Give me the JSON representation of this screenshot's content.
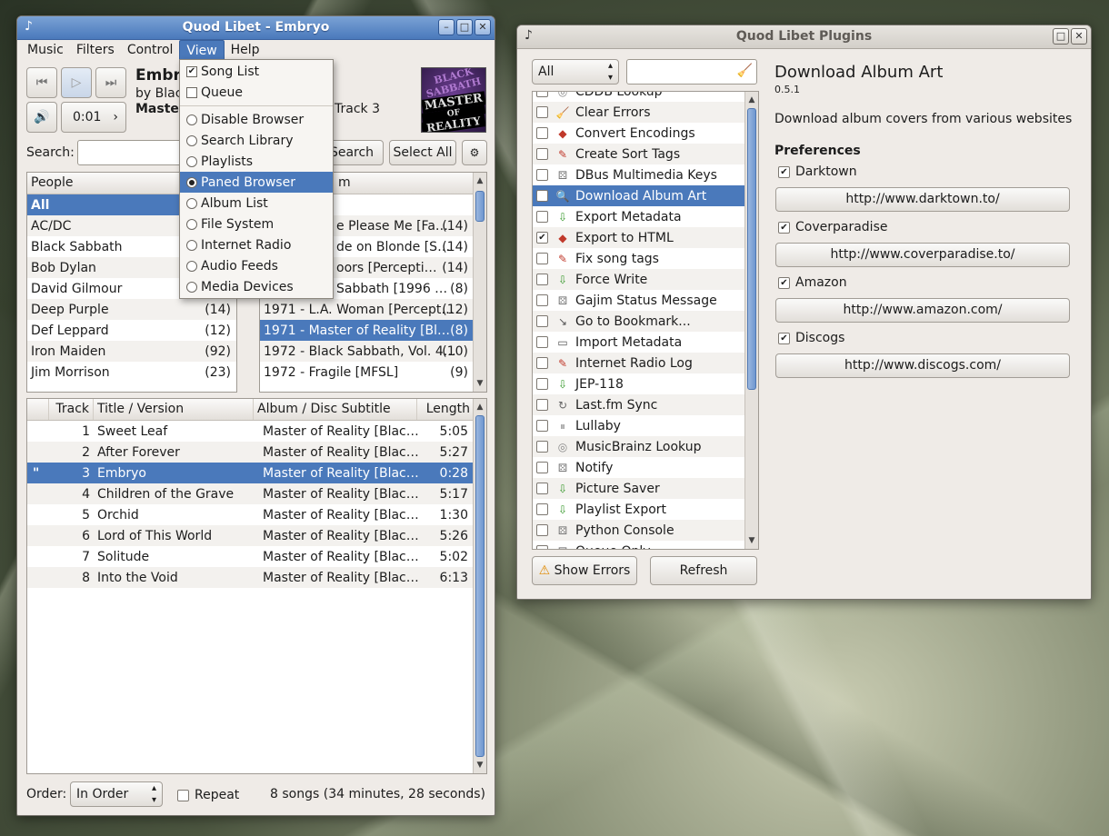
{
  "main": {
    "title": "Quod Libet - Embryo",
    "menus": [
      "Music",
      "Filters",
      "Control",
      "View",
      "Help"
    ],
    "now_playing": {
      "title": "Embryo",
      "by": "by Black Sabbath",
      "album": "Master of Reality",
      "track": "Track 3",
      "time": "0:01"
    },
    "cover": {
      "line1": "BLACK",
      "line2": "SABBATH",
      "line3": "MASTER",
      "line4": "OF",
      "line5": "REALITY"
    },
    "search_label": "Search:",
    "search_button": "Search",
    "select_all_button": "Select All",
    "people_header": "People",
    "people": [
      {
        "name": "All",
        "count": ""
      },
      {
        "name": "AC/DC",
        "count": ""
      },
      {
        "name": "Black Sabbath",
        "count": ""
      },
      {
        "name": "Bob Dylan",
        "count": ""
      },
      {
        "name": "David Gilmour",
        "count": ""
      },
      {
        "name": "Deep Purple",
        "count": "(14)"
      },
      {
        "name": "Def Leppard",
        "count": "(12)"
      },
      {
        "name": "Iron Maiden",
        "count": "(92)"
      },
      {
        "name": "Jim Morrison",
        "count": "(23)"
      }
    ],
    "albums_header": "m",
    "albums": [
      {
        "name": "e Please Me [Fa…",
        "count": "(14)"
      },
      {
        "name": "de on Blonde [S…",
        "count": "(14)"
      },
      {
        "name": "oors [Percepti…",
        "count": "(14)"
      },
      {
        "name": "Sabbath [1996 …",
        "count": "(8)"
      },
      {
        "name": "1971 - L.A. Woman [Percept…",
        "count": "(12)"
      },
      {
        "name": "1971 - Master of Reality [Bl…",
        "count": "(8)"
      },
      {
        "name": "1972 - Black Sabbath, Vol. 4…",
        "count": "(10)"
      },
      {
        "name": "1972 - Fragile [MFSL]",
        "count": "(9)"
      }
    ],
    "songs_headers": {
      "track": "Track",
      "title": "Title / Version",
      "album": "Album / Disc Subtitle",
      "length": "Length"
    },
    "songs": [
      {
        "num": "1",
        "title": "Sweet Leaf",
        "album": "Master of Reality [Blac…",
        "length": "5:05"
      },
      {
        "num": "2",
        "title": "After Forever",
        "album": "Master of Reality [Blac…",
        "length": "5:27"
      },
      {
        "num": "3",
        "title": "Embryo",
        "album": "Master of Reality [Blac…",
        "length": "0:28"
      },
      {
        "num": "4",
        "title": "Children of the Grave",
        "album": "Master of Reality [Blac…",
        "length": "5:17"
      },
      {
        "num": "5",
        "title": "Orchid",
        "album": "Master of Reality [Blac…",
        "length": "1:30"
      },
      {
        "num": "6",
        "title": "Lord of This World",
        "album": "Master of Reality [Blac…",
        "length": "5:26"
      },
      {
        "num": "7",
        "title": "Solitude",
        "album": "Master of Reality [Blac…",
        "length": "5:02"
      },
      {
        "num": "8",
        "title": "Into the Void",
        "album": "Master of Reality [Blac…",
        "length": "6:13"
      }
    ],
    "playing_marker": "\"",
    "order_label": "Order:",
    "order_value": "In Order",
    "repeat_label": "Repeat",
    "status": "8 songs (34 minutes, 28 seconds)"
  },
  "view_menu": {
    "checks": [
      {
        "label": "Song List",
        "checked": true
      },
      {
        "label": "Queue",
        "checked": false
      }
    ],
    "radios": [
      {
        "label": "Disable Browser",
        "selected": false
      },
      {
        "label": "Search Library",
        "selected": false
      },
      {
        "label": "Playlists",
        "selected": false
      },
      {
        "label": "Paned Browser",
        "selected": true
      },
      {
        "label": "Album List",
        "selected": false
      },
      {
        "label": "File System",
        "selected": false
      },
      {
        "label": "Internet Radio",
        "selected": false
      },
      {
        "label": "Audio Feeds",
        "selected": false
      },
      {
        "label": "Media Devices",
        "selected": false
      }
    ]
  },
  "plugins": {
    "title": "Quod Libet Plugins",
    "filter_value": "All",
    "list": [
      {
        "name": "CDDB Lookup",
        "icon": "cd",
        "checked": false
      },
      {
        "name": "Clear Errors",
        "icon": "broom",
        "checked": false
      },
      {
        "name": "Convert Encodings",
        "icon": "convert",
        "checked": false
      },
      {
        "name": "Create Sort Tags",
        "icon": "edit",
        "checked": false
      },
      {
        "name": "DBus Multimedia Keys",
        "icon": "puzzle",
        "checked": false
      },
      {
        "name": "Download Album Art",
        "icon": "magnifier",
        "checked": false,
        "selected": true
      },
      {
        "name": "Export Metadata",
        "icon": "export",
        "checked": false
      },
      {
        "name": "Export to HTML",
        "icon": "convert",
        "checked": true
      },
      {
        "name": "Fix song tags",
        "icon": "edit",
        "checked": false
      },
      {
        "name": "Force Write",
        "icon": "export",
        "checked": false
      },
      {
        "name": "Gajim Status Message",
        "icon": "puzzle",
        "checked": false
      },
      {
        "name": "Go to Bookmark...",
        "icon": "goto",
        "checked": false
      },
      {
        "name": "Import Metadata",
        "icon": "import",
        "checked": false
      },
      {
        "name": "Internet Radio Log",
        "icon": "edit",
        "checked": false
      },
      {
        "name": "JEP-118",
        "icon": "export",
        "checked": false
      },
      {
        "name": "Last.fm Sync",
        "icon": "sync",
        "checked": false
      },
      {
        "name": "Lullaby",
        "icon": "pause",
        "checked": false
      },
      {
        "name": "MusicBrainz Lookup",
        "icon": "cd",
        "checked": false
      },
      {
        "name": "Notify",
        "icon": "puzzle",
        "checked": false
      },
      {
        "name": "Picture Saver",
        "icon": "export",
        "checked": false
      },
      {
        "name": "Playlist Export",
        "icon": "export",
        "checked": false
      },
      {
        "name": "Python Console",
        "icon": "puzzle",
        "checked": false
      },
      {
        "name": "Queue Only",
        "icon": "puzzle",
        "checked": false
      }
    ],
    "show_errors_button": "Show Errors",
    "refresh_button": "Refresh",
    "detail": {
      "name": "Download Album Art",
      "version": "0.5.1",
      "description": "Download album covers from various websites",
      "prefs_heading": "Preferences",
      "sites": [
        {
          "name": "Darktown",
          "url": "http://www.darktown.to/",
          "checked": true
        },
        {
          "name": "Coverparadise",
          "url": "http://www.coverparadise.to/",
          "checked": true
        },
        {
          "name": "Amazon",
          "url": "http://www.amazon.com/",
          "checked": true
        },
        {
          "name": "Discogs",
          "url": "http://www.discogs.com/",
          "checked": true
        }
      ]
    }
  },
  "colors": {
    "selection": "#4a79bb",
    "window_bg": "#efebe7",
    "titlebar_active": "#4a79bb"
  }
}
